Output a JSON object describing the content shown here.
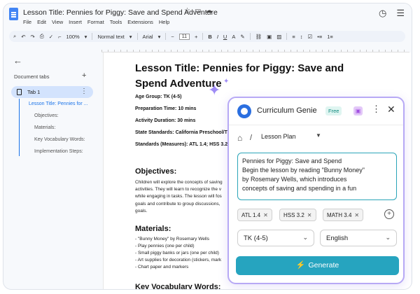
{
  "doc": {
    "title": "Lesson Title: Pennies for Piggy: Save and Spend Adventure",
    "menu": [
      "File",
      "Edit",
      "View",
      "Insert",
      "Format",
      "Tools",
      "Extensions",
      "Help"
    ],
    "toolbar": {
      "zoom": "100%",
      "style": "Normal text",
      "font": "Arial",
      "font_size": "11"
    }
  },
  "sidebar": {
    "heading": "Document tabs",
    "tab_label": "Tab 1",
    "outline": [
      "Lesson Title: Pennies for ...",
      "Objectives:",
      "Materials:",
      "Key Vocabulary Words:",
      "Implementation Steps:"
    ]
  },
  "page": {
    "heading": "Lesson Title: Pennies for Piggy: Save and Spend Adventure",
    "meta": [
      "Age Group: TK (4-5)",
      "Preparation Time: 10 mins",
      "Activity Duration: 30 mins",
      "State Standards: California Preschool/T",
      "Standards (Measures): ATL 1.4; HSS 3.2"
    ],
    "objectives_heading": "Objectives:",
    "objectives_lines": [
      "Children will explore the concepts of saving",
      "activities. They will learn to recognize the v",
      "while engaging in tasks. The lesson will fos",
      "goals and contribute to group discussions,",
      "goals."
    ],
    "materials_heading": "Materials:",
    "materials": [
      "- \"Bunny Money\" by Rosemary Wells",
      "- Play pennies (one per child)",
      "- Small piggy banks or jars (one per child)",
      "- Art supplies for decoration (stickers, mark",
      "- Chart paper and markers"
    ],
    "vocab_heading": "Key Vocabulary Words:"
  },
  "genie": {
    "title": "Curriculum Genie",
    "badge": "Free",
    "breadcrumb": "Lesson Plan",
    "text_lines": [
      "Pennies for Piggy: Save and Spend",
      "Begin the lesson by reading \"Bunny Money\"",
      "by Rosemary Wells, which introduces",
      "concepts of saving and spending in a fun"
    ],
    "chips": [
      "ATL 1.4",
      "HSS 3.2",
      "MATH 3.4"
    ],
    "age_select": "TK (4-5)",
    "language_select": "English",
    "generate_label": "Generate"
  },
  "colors": {
    "accent": "#26a4bf",
    "panel_border": "#b7a9f5",
    "tab_highlight": "#d3e3fd",
    "outline_accent": "#1a73e8"
  }
}
